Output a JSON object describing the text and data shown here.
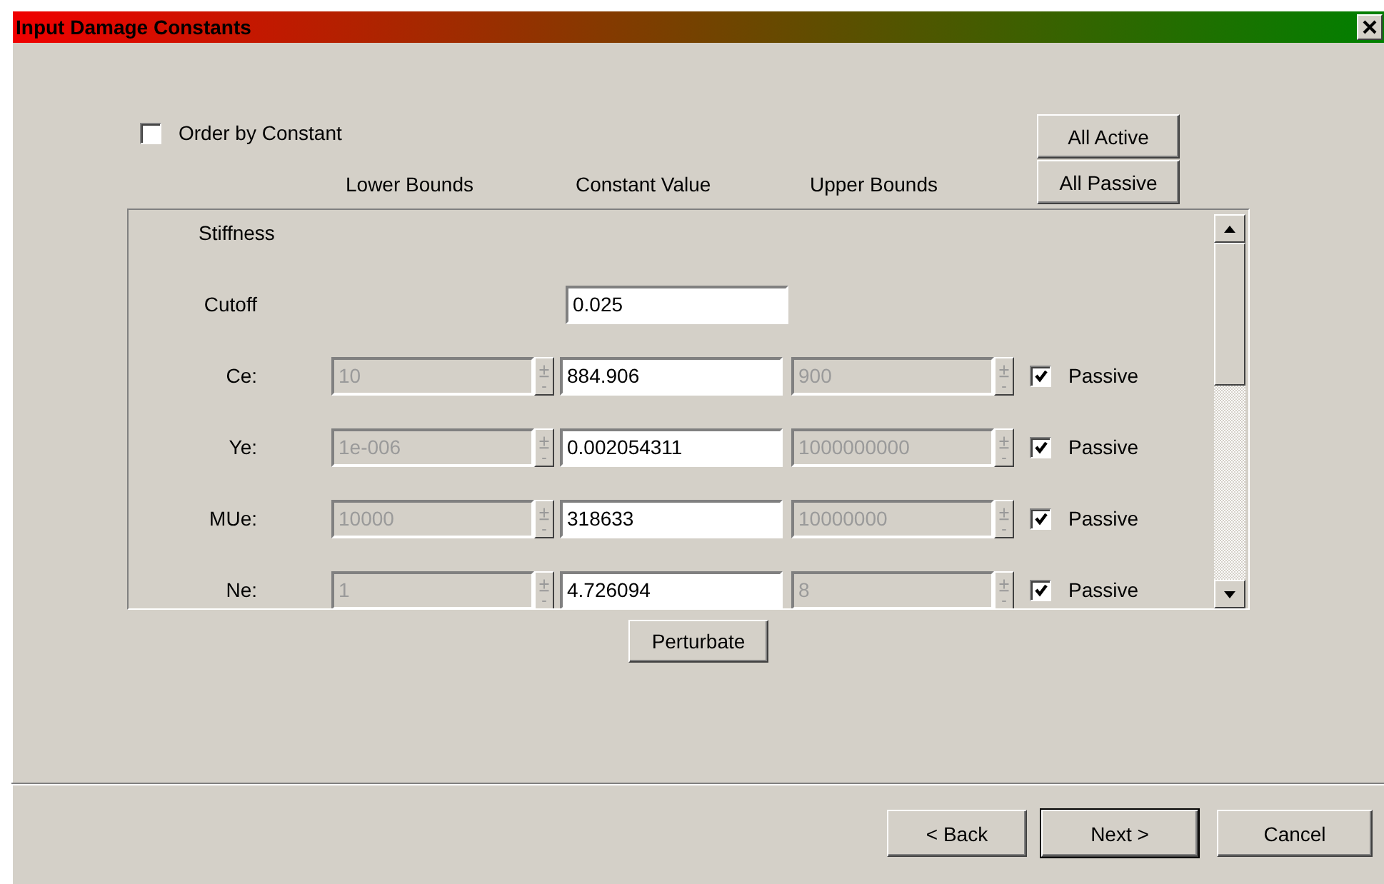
{
  "window": {
    "title": "Input Damage Constants"
  },
  "order_by_constant": {
    "label": "Order by Constant",
    "checked": false
  },
  "mode_buttons": [
    "All Active",
    "All Passive"
  ],
  "columns": [
    "Lower Bounds",
    "Constant Value",
    "Upper Bounds"
  ],
  "group": "Stiffness",
  "cutoff": {
    "label": "Cutoff",
    "value": "0.025"
  },
  "constants": [
    {
      "label": "Ce:",
      "lower": "10",
      "value": "884.906",
      "upper": "900",
      "bounds_disabled": true,
      "passive_label": "Passive",
      "passive": true
    },
    {
      "label": "Ye:",
      "lower": "1e-006",
      "value": "0.002054311",
      "upper": "1000000000",
      "bounds_disabled": true,
      "passive_label": "Passive",
      "passive": true
    },
    {
      "label": "MUe:",
      "lower": "10000",
      "value": "318633",
      "upper": "10000000",
      "bounds_disabled": true,
      "passive_label": "Passive",
      "passive": true
    },
    {
      "label": "Ne:",
      "lower": "1",
      "value": "4.726094",
      "upper": "8",
      "bounds_disabled": true,
      "passive_label": "Passive",
      "passive": true
    }
  ],
  "perturbate_button": "Perturbate",
  "footer_buttons": [
    {
      "label": "< Back",
      "default": false
    },
    {
      "label": "Next >",
      "default": true
    },
    {
      "label": "Cancel",
      "default": false
    }
  ]
}
